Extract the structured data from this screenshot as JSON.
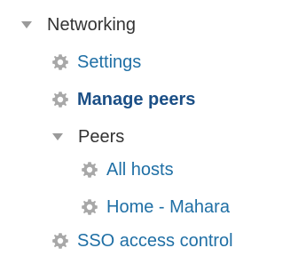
{
  "nav": {
    "networking": {
      "label": "Networking"
    },
    "settings": {
      "label": "Settings"
    },
    "manage_peers": {
      "label": "Manage peers"
    },
    "peers": {
      "label": "Peers",
      "children": {
        "all_hosts": {
          "label": "All hosts"
        },
        "home_mahara": {
          "label": "Home - Mahara"
        }
      }
    },
    "sso_access_control": {
      "label": "SSO access control"
    }
  },
  "colors": {
    "link": "#1f6fa5",
    "active_link": "#1b4f86",
    "text": "#333333",
    "icon": "#a8a8a8"
  },
  "icons": {
    "expand": "triangle-down-icon",
    "item": "gear-icon"
  }
}
